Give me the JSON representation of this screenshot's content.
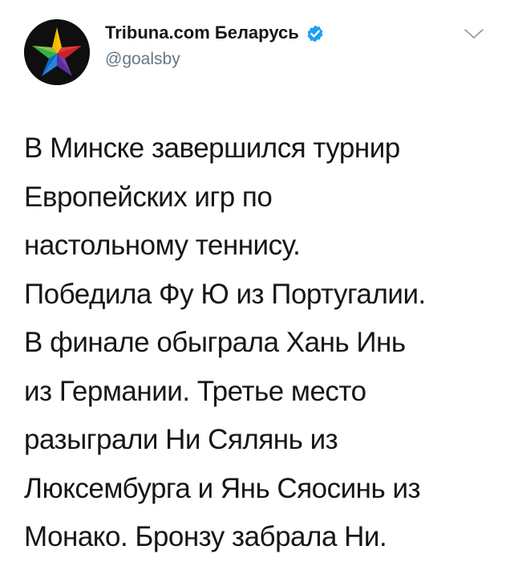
{
  "tweet": {
    "author_name": "Tribuna.com Беларусь",
    "handle": "@goalsby",
    "verified": true,
    "colors": {
      "text": "#14171a",
      "secondary": "#657786",
      "verified": "#1da1f2"
    },
    "avatar_icon": "multicolor-star-logo",
    "body_lines": [
      "В Минске завершился турнир",
      "Европейских игр по",
      "настольному теннису.",
      "Победила Фу Ю из Португалии.",
      "В финале обыграла Хань Инь",
      "из Германии. Третье место",
      "разыграли Ни Сялянь из",
      "Люксембурга и Янь Сяосинь из",
      "Монако. Бронзу забрала Ни."
    ]
  }
}
